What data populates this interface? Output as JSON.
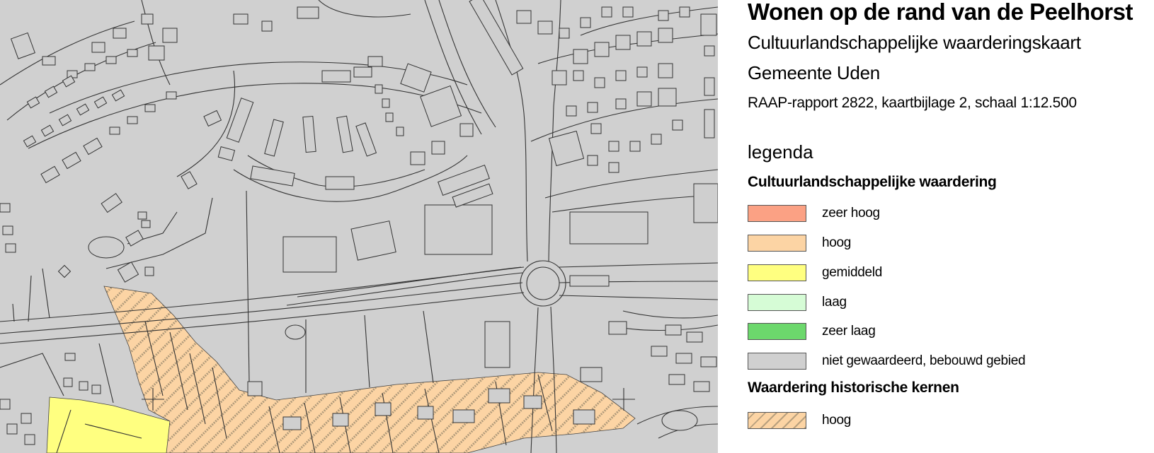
{
  "title": "Wonen op de rand van de Peelhorst",
  "subtitle": "Cultuurlandschappelijke waarderingskaart",
  "municipality": "Gemeente Uden",
  "report": "RAAP-rapport 2822, kaartbijlage 2, schaal 1:12.500",
  "legend": {
    "heading": "legenda",
    "group1": "Cultuurlandschappelijke waardering",
    "items": [
      {
        "label": "zeer hoog",
        "color": "#fba184"
      },
      {
        "label": "hoog",
        "color": "#fcd4a4"
      },
      {
        "label": "gemiddeld",
        "color": "#ffff80"
      },
      {
        "label": "laag",
        "color": "#d6fcd6"
      },
      {
        "label": "zeer laag",
        "color": "#6cd86c"
      },
      {
        "label": "niet gewaardeerd, bebouwd gebied",
        "color": "#d0d0d0"
      }
    ],
    "group2": "Waardering historische kernen",
    "hatched_items": [
      {
        "label": "hoog",
        "color": "#fcd4a4",
        "pattern": "diagonal-hatch"
      }
    ]
  },
  "map": {
    "background_color": "#d0d0d0",
    "zones": [
      {
        "name": "historic-core-hoog",
        "value": "hoog",
        "pattern": "diagonal-hatch"
      },
      {
        "name": "zone-gemiddeld",
        "value": "gemiddeld"
      }
    ]
  }
}
